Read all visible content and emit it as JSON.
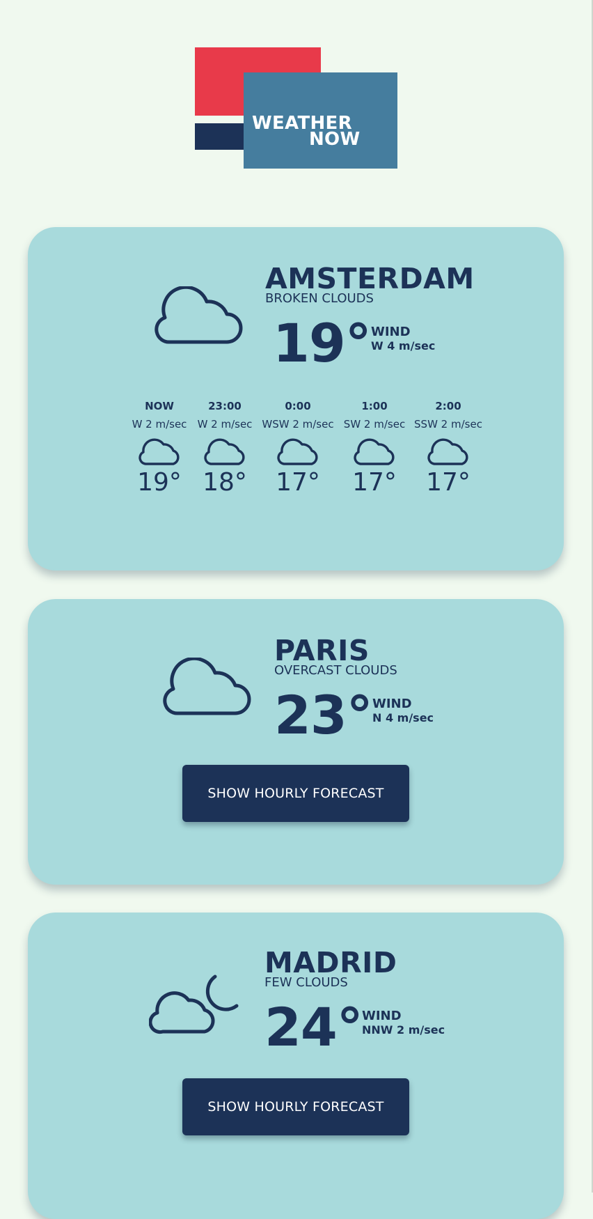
{
  "logo": {
    "line1": "WEATHER",
    "line2": "NOW"
  },
  "colors": {
    "background": "#f0f9ef",
    "card": "#a8dadc",
    "navy": "#1c3257",
    "red": "#e83a4a",
    "steel_blue": "#457d9e",
    "button_text": "#ffffff"
  },
  "cities": [
    {
      "name": "AMSTERDAM",
      "condition": "BROKEN CLOUDS",
      "icon": "cloud-icon",
      "temp": "19°",
      "wind_label": "WIND",
      "wind": "W 4 m/sec",
      "hourly": [
        {
          "time": "NOW",
          "wind": "W 2 m/sec",
          "icon": "cloud-icon",
          "temp": "19°"
        },
        {
          "time": "23:00",
          "wind": "W 2 m/sec",
          "icon": "cloud-icon",
          "temp": "18°"
        },
        {
          "time": "0:00",
          "wind": "WSW 2 m/sec",
          "icon": "cloud-icon",
          "temp": "17°"
        },
        {
          "time": "1:00",
          "wind": "SW 2 m/sec",
          "icon": "cloud-icon",
          "temp": "17°"
        },
        {
          "time": "2:00",
          "wind": "SSW 2 m/sec",
          "icon": "cloud-icon",
          "temp": "17°"
        }
      ]
    },
    {
      "name": "PARIS",
      "condition": "OVERCAST CLOUDS",
      "icon": "cloud-icon",
      "temp": "23°",
      "wind_label": "WIND",
      "wind": "N 4 m/sec",
      "button_label": "SHOW HOURLY FORECAST"
    },
    {
      "name": "MADRID",
      "condition": "FEW CLOUDS",
      "icon": "cloud-moon-icon",
      "temp": "24°",
      "wind_label": "WIND",
      "wind": "NNW 2 m/sec",
      "button_label": "SHOW HOURLY FORECAST"
    }
  ]
}
